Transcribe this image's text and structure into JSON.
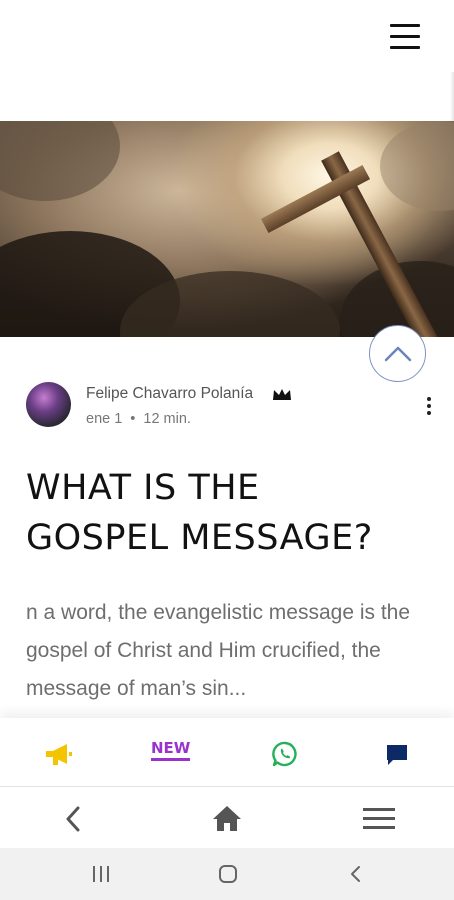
{
  "header": {
    "menu_icon": "hamburger-icon"
  },
  "hero": {
    "image_description_icon": "cross-image"
  },
  "post": {
    "author": "Felipe Chavarro Polanía",
    "author_badge_icon": "crown-icon",
    "date": "ene 1",
    "separator": "•",
    "read_time": "12 min.",
    "more_icon": "kebab-menu-icon",
    "title_line1": "WHAT IS THE",
    "title_line2": "GOSPEL MESSAGE?",
    "excerpt": "n a word, the evangelistic message is the gospel of Christ and Him crucified, the message of man’s sin..."
  },
  "scroll_up": {
    "icon": "chevron-up-icon"
  },
  "bottom_tabs": {
    "new_label": "NEW",
    "icons": [
      "megaphone-icon",
      "new-badge",
      "whatsapp-icon",
      "chat-icon"
    ],
    "colors": {
      "megaphone": "#f5c400",
      "new": "#9933cc",
      "whatsapp": "#25b05a",
      "chat": "#0d2a66"
    }
  },
  "app_nav": {
    "icons": [
      "back-icon",
      "home-icon",
      "menu-icon"
    ]
  },
  "system_nav": {
    "icons": [
      "recents-icon",
      "home-circle-icon",
      "system-back-icon"
    ]
  }
}
